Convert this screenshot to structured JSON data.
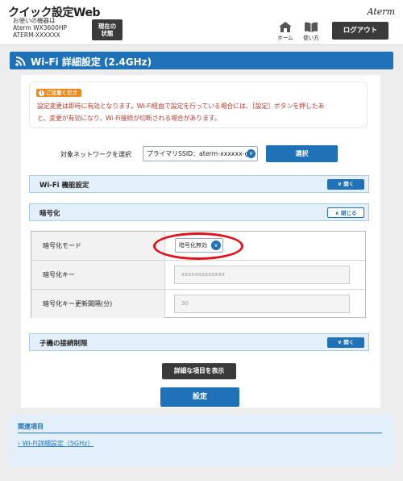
{
  "header": {
    "title": "クイック設定Web",
    "device_line1": "お使いの機器は",
    "device_line2": "Aterm WX3600HP",
    "device_line3": "ATERM-XXXXXX",
    "status_line1": "現在の",
    "status_line2": "状態",
    "brand": "Aterm",
    "home_label": "ホーム",
    "manual_label": "使い方",
    "logout_label": "ログアウト"
  },
  "page": {
    "title": "Wi-Fi 詳細設定 (2.4GHz)"
  },
  "notice": {
    "badge": "ご注意ください",
    "line1": "設定変更は即時に有効となります。Wi-Fi経由で設定を行っている場合には、［設定］ボタンを押したあ",
    "line2": "と、変更が有効になり、Wi-Fi接続が切断される場合があります。"
  },
  "network_select": {
    "label": "対象ネットワークを選択",
    "value": "プライマリSSID：aterm-xxxxxx-g",
    "button": "選択"
  },
  "sections": {
    "wifi_function": {
      "title": "Wi-Fi 機能設定",
      "toggle": "開く"
    },
    "encryption": {
      "title": "暗号化",
      "toggle": "閉じる"
    },
    "client_limit": {
      "title": "子機の接続制限",
      "toggle": "開く"
    }
  },
  "encryption_table": {
    "mode_label": "暗号化モード",
    "mode_value": "暗号化無効",
    "key_label": "暗号化キー",
    "key_value": "xxxxxxxxxxxxx",
    "interval_label": "暗号化キー更新間隔(分)",
    "interval_value": "30"
  },
  "buttons": {
    "show_details": "詳細な項目を表示",
    "apply": "設定"
  },
  "related": {
    "title": "関連項目",
    "link": "Wi-Fi詳細設定（5GHz）"
  },
  "colors": {
    "accent": "#1f72b8",
    "warning": "#f08a1a",
    "error_text": "#c0392b",
    "highlight": "#e0141e"
  }
}
